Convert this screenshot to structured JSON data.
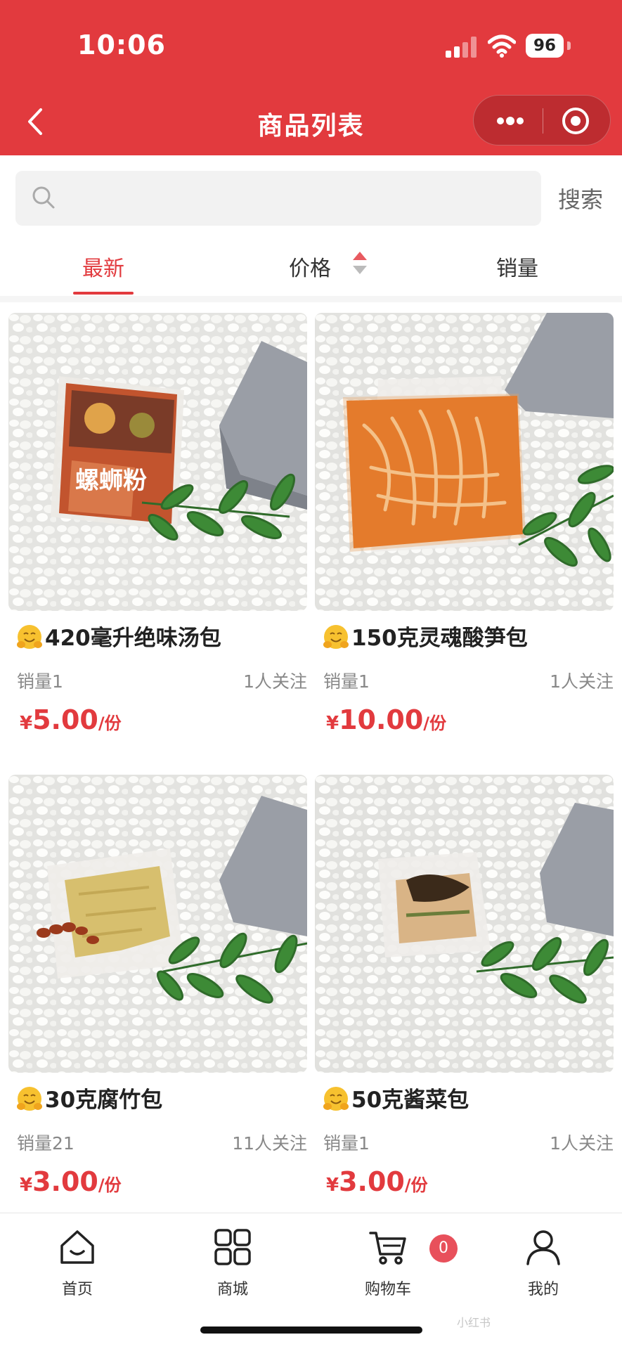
{
  "status_bar": {
    "time": "10:06",
    "battery": "96",
    "signal_bars": 2,
    "signal_total": 4
  },
  "nav": {
    "title": "商品列表"
  },
  "search": {
    "placeholder": "",
    "value": "",
    "button": "搜索"
  },
  "sort_tabs": [
    {
      "label": "最新",
      "active": true
    },
    {
      "label": "价格",
      "active": false
    },
    {
      "label": "销量",
      "active": false
    }
  ],
  "products": [
    {
      "title": "420毫升绝味汤包",
      "sales": "销量1",
      "follows": "1人关注",
      "currency": "¥",
      "price": "5.00",
      "unit": "/份",
      "image": "snail-noodle-soup-pouch",
      "pouch_text": "螺蛳粉"
    },
    {
      "title": "150克灵魂酸笋包",
      "sales": "销量1",
      "follows": "1人关注",
      "currency": "¥",
      "price": "10.00",
      "unit": "/份",
      "image": "sour-bamboo-shoot-pack"
    },
    {
      "title": "30克腐竹包",
      "sales": "销量21",
      "follows": "11人关注",
      "currency": "¥",
      "price": "3.00",
      "unit": "/份",
      "image": "tofu-skin-pack"
    },
    {
      "title": "50克酱菜包",
      "sales": "销量1",
      "follows": "1人关注",
      "currency": "¥",
      "price": "3.00",
      "unit": "/份",
      "image": "pickled-vegetable-pack"
    }
  ],
  "tabbar": [
    {
      "label": "首页",
      "icon": "home-icon"
    },
    {
      "label": "商城",
      "icon": "grid-icon"
    },
    {
      "label": "购物车",
      "icon": "cart-icon",
      "badge": "0"
    },
    {
      "label": "我的",
      "icon": "user-icon"
    }
  ],
  "watermark": "小红书",
  "colors": {
    "brand": "#e23a3e",
    "price": "#e23a3e",
    "badge": "#e8505b"
  }
}
